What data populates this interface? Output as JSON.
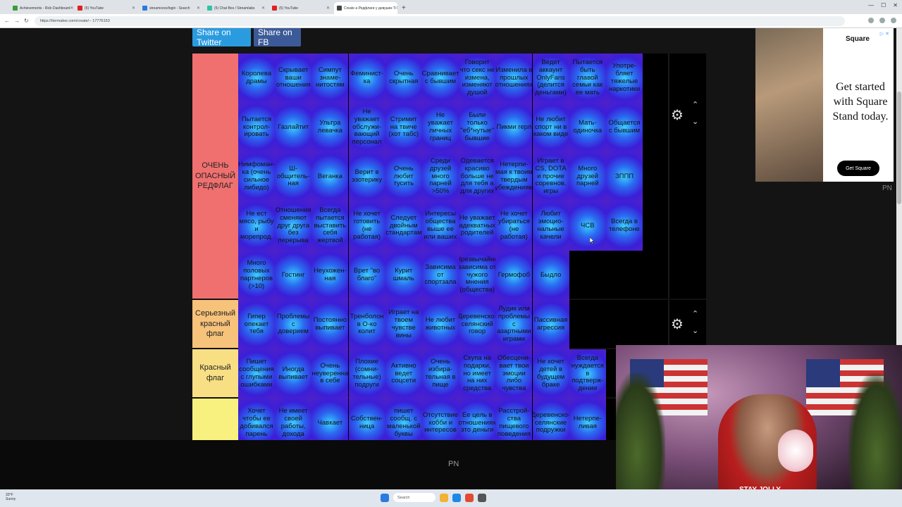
{
  "browser": {
    "tabs": [
      {
        "label": "Achievements - Rick Dashboard",
        "color": "#3a9c3a"
      },
      {
        "label": "(5) YouTube",
        "color": "#e02020"
      },
      {
        "label": "streamxxxx/login - Search",
        "color": "#2a7ae2"
      },
      {
        "label": "(5) Chat Box / Streamlabs",
        "color": "#31c3a2"
      },
      {
        "label": "(5) YouTube",
        "color": "#e02020"
      },
      {
        "label": "Create a Редфлаги у девушек Ti",
        "color": "#444444",
        "active": true
      }
    ],
    "new_tab": "+",
    "url": "https://tiermaker.com/create/-- 17776153"
  },
  "page": {
    "share_twitter": "Share on Twitter",
    "share_fb": "Share on FB"
  },
  "tiers": [
    {
      "label": "ОЧЕНЬ ОПАСНЫЙ РЕДФЛАГ",
      "color": "#f07070",
      "rows": [
        [
          "Королева драмы",
          "Скрывает ваши отношения",
          "Симпут знаме-нитостям",
          "Феминист-ка",
          "Очень скрытная",
          "Сравнивает с бывшим",
          "Говорит что секс не измена, изменяют душой",
          "Изменила в прошлых отношениях",
          "Ведет аккаунт OnlyFans (делится деньгами)",
          "Пытается быть главой семьи как ее мать",
          "Употре-бляет тяжелые наркотики"
        ],
        [
          "Пытается контрол-ировать",
          "Газлайтит",
          "Ультра левачка",
          "Не уважает обслужи-вающий персонал",
          "Стримит на твиче (хот табс)",
          "Не уважает личных границ",
          "Были только \"еб*нутые\" бывшие",
          "Пикми герл",
          "Не любит спорт ни в каком виде",
          "Мать-одиночка",
          "Общается с бывшим"
        ],
        [
          "Нимфоман-ка (очень сильное либидо)",
          "Ш-общитель-ная",
          "Веганка",
          "Верит в эзотерику",
          "Очень любит тусить",
          "Среди друзей много парней >50%",
          "Одевается красиво больше не для тебя а для других",
          "Нетерпи-мая к твоим твердым убеждениям",
          "Играет в CS, DOTA и прочие соревнов. игры",
          "Много друзей парней",
          "ЗППП"
        ],
        [
          "Не ест мясо, рыбу и морепрод.",
          "Отношения сменяют друг друга без перерыва",
          "Всегда пытается выставить себя жертвой",
          "Не хочет готовить (не работая)",
          "Следует двойным стандартам",
          "Интересы общества выше ее или ваших",
          "Не уважает адекватных родителей",
          "Не хочет убираться (не работая)",
          "Любит эмоцио-нальные качели",
          "ЧСВ",
          "Всегда в телефоне"
        ],
        [
          "Много половых партнеров (>10)",
          "Гостинг",
          "Неухожен-ная",
          "Врет \"во благо\"",
          "Курит шмаль",
          "Зависима от спортзала",
          "Чрезвычайно зависима от чужого мнения (общества)",
          "Гермофоб",
          "Быдло"
        ]
      ]
    },
    {
      "label": "Серьезный красный флаг",
      "color": "#f7c27a",
      "rows": [
        [
          "Гипер опекает тебя",
          "Проблемы с доверием",
          "Постоянно выпивает",
          "Тренболон в О-ко колит",
          "Играет на твоем чувстве вины",
          "Не любит животных",
          "Деревенско-селянский говор",
          "Лудик или проблемы с азартными играми",
          "Пассивная агрессия"
        ]
      ]
    },
    {
      "label": "Красный флаг",
      "color": "#f9df84",
      "rows": [
        [
          "Пишет сообщения с глупыми ошибками",
          "Иногда выпивает",
          "Очень неуверенна в себе",
          "Плохие (сомни-тельные) подруги",
          "Активно ведет соцсети",
          "Очень избира-тельная в пище",
          "Скупа на подарки, но имеет на них средства",
          "Обесцени-вает твои эмоции либо чувства",
          "Не хочет детей в будущем браке",
          "Всегда нуждается в подтверж-дении"
        ]
      ]
    },
    {
      "label": "",
      "color": "#f9f17f",
      "rows": [
        [
          "Хочет чтобы ее добивался парень",
          "Не имеет своей работы, дохода",
          "Чавкает",
          "Собствен-ница",
          "пишет сообщ. с маленькой буквы",
          "Отсутствие хобби и интересов",
          "Ее цель в отношениях это деньги",
          "Расстрой-ства пищевого поведения",
          "Деревенско-селянские подружки",
          "Нетерпе-ливая"
        ]
      ]
    }
  ],
  "controls": {
    "gear": "⚙",
    "up": "⌃",
    "down": "⌄"
  },
  "ad": {
    "brand": "Square",
    "headline": "Get started with Square Stand today.",
    "button": "Get Square",
    "marker": "▷ ✕",
    "pn_right": "PN"
  },
  "bottom": {
    "pn": "PN"
  },
  "taskbar": {
    "weather": "33°F\nSunny",
    "search": "Search"
  },
  "webcam": {
    "shirt_text": "STAY JOLLY"
  },
  "colors": {
    "page_bg": "#141414",
    "accent_twitter": "#2b9be0",
    "accent_fb": "#3d5a98"
  }
}
